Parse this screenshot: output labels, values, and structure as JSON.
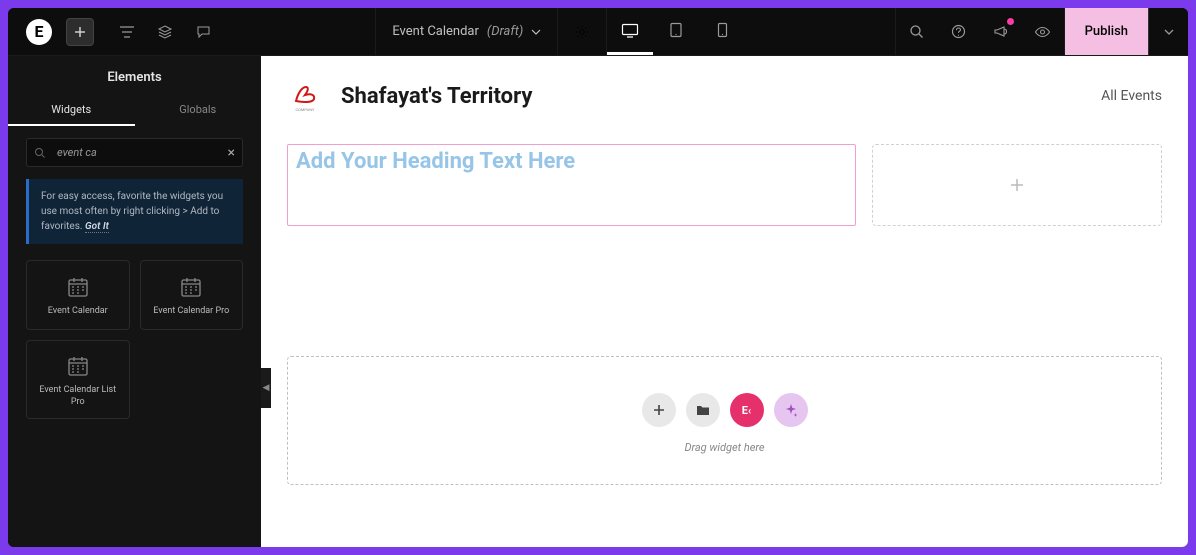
{
  "topbar": {
    "doc_title": "Event Calendar",
    "doc_status": "(Draft)"
  },
  "publish_label": "Publish",
  "sidebar": {
    "title": "Elements",
    "tabs": {
      "widgets": "Widgets",
      "globals": "Globals"
    },
    "search_value": "event ca",
    "tip_text": "For easy access, favorite the widgets you use most often by right clicking > Add to favorites.",
    "tip_link": "Got It",
    "widgets": [
      {
        "label": "Event Calendar"
      },
      {
        "label": "Event Calendar Pro"
      },
      {
        "label": "Event Calendar List Pro"
      }
    ]
  },
  "canvas": {
    "brand_name": "Shafayat's Territory",
    "nav_all_events": "All Events",
    "heading_placeholder": "Add Your Heading Text Here",
    "drop_hint": "Drag widget here",
    "ek_label": "E‹"
  }
}
